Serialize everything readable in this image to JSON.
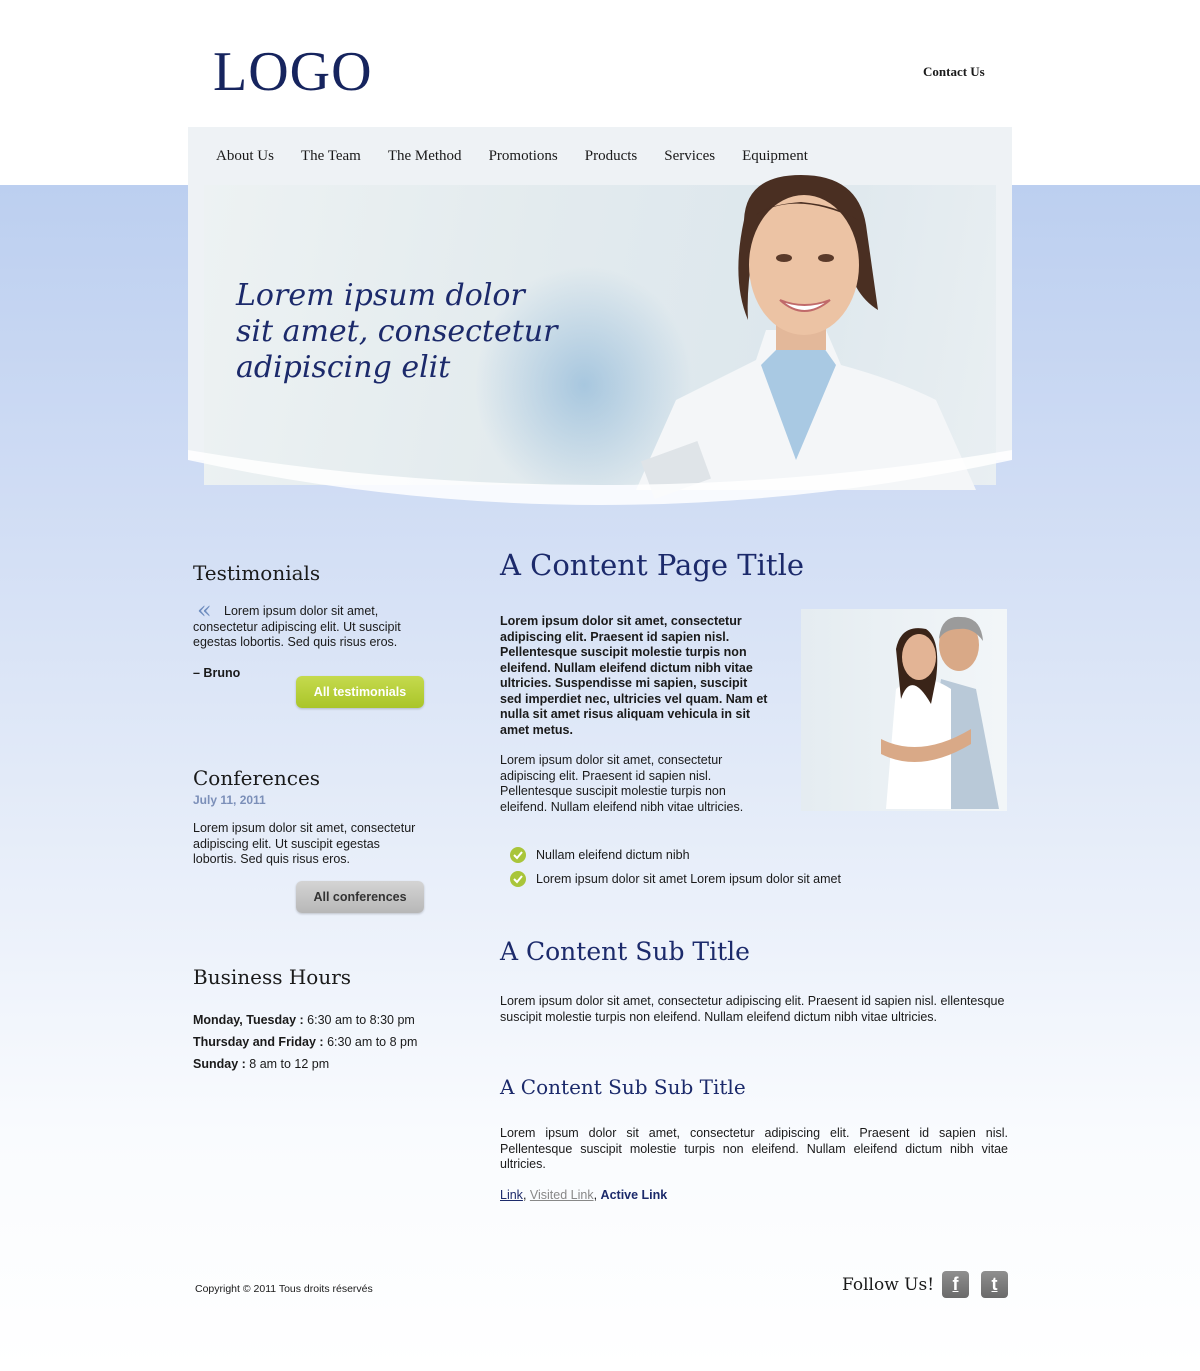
{
  "header": {
    "logo": "LOGO",
    "contact": "Contact Us"
  },
  "nav": [
    "About Us",
    "The Team",
    "The Method",
    "Promotions",
    "Products",
    "Services",
    "Equipment"
  ],
  "hero": {
    "line1": "Lorem ipsum dolor",
    "line2": "sit amet, consectetur",
    "line3": "adipiscing elit"
  },
  "sidebar": {
    "testimonials": {
      "title": "Testimonials",
      "quote": "Lorem ipsum dolor sit amet, consectetur adipiscing elit. Ut suscipit egestas lobortis. Sed quis risus eros.",
      "author": "– Bruno",
      "button": "All testimonials"
    },
    "conferences": {
      "title": "Conferences",
      "date": "July 11, 2011",
      "text": "Lorem ipsum dolor sit amet, consectetur adipiscing elit. Ut suscipit egestas lobortis. Sed quis risus eros.",
      "button": "All conferences"
    },
    "hours": {
      "title": "Business Hours",
      "rows": [
        {
          "day": "Monday, Tuesday :",
          "time": " 6:30 am to 8:30 pm"
        },
        {
          "day": "Thursday and Friday :",
          "time": " 6:30 am to 8 pm"
        },
        {
          "day": "Sunday :",
          "time": " 8 am to 12 pm"
        }
      ]
    }
  },
  "content": {
    "title": "A Content Page Title",
    "bold_paragraph": "Lorem ipsum dolor sit amet, consectetur adipiscing elit. Praesent id sapien nisl. Pellentesque suscipit molestie turpis non eleifend. Nullam eleifend dictum nibh vitae ultricies. Suspendisse mi sapien, suscipit sed imperdiet nec, ultricies vel quam. Nam et nulla sit amet risus aliquam vehicula in sit amet metus.",
    "paragraph": "Lorem ipsum dolor sit amet, consectetur adipiscing elit. Praesent id sapien nisl. Pellentesque suscipit molestie turpis non eleifend. Nullam eleifend nibh vitae ultricies.",
    "checklist": [
      "Nullam eleifend dictum nibh",
      "Lorem ipsum dolor sit amet Lorem ipsum dolor sit amet"
    ],
    "sub_title": "A Content Sub Title",
    "sub_text": "Lorem ipsum dolor sit amet, consectetur adipiscing elit. Praesent id sapien nisl. ellentesque suscipit molestie turpis non eleifend. Nullam eleifend dictum nibh vitae ultricies.",
    "subsub_title": "A Content Sub Sub Title",
    "subsub_text": "Lorem ipsum dolor sit amet, consectetur adipiscing elit. Praesent id sapien nisl. Pellentesque suscipit molestie turpis non eleifend. Nullam eleifend dictum nibh vitae ultricies.",
    "links": {
      "link": "Link",
      "visited": "Visited Link",
      "active": "Active Link",
      "sep": ", "
    }
  },
  "footer": {
    "copyright": "Copyright © 2011 Tous droits réservés",
    "follow": "Follow Us!",
    "social": [
      "facebook-icon",
      "twitter-icon"
    ]
  },
  "colors": {
    "brand_navy": "#1c2a6b",
    "accent_green": "#aac529",
    "background_blue": "#bccff0"
  }
}
